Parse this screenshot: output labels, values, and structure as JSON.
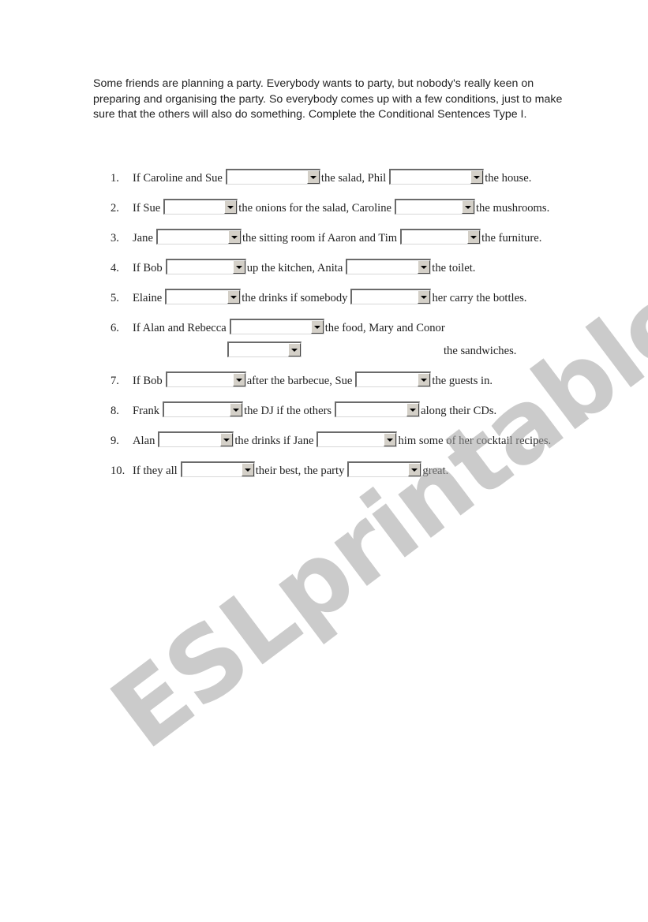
{
  "intro": "Some friends are planning a party. Everybody wants to party, but nobody's really keen on preparing and organising the party. So everybody comes up with a few conditions, just to make sure that the others will also do something. Complete the Conditional Sentences Type I.",
  "items": [
    {
      "num": "1.",
      "parts": [
        "If Caroline and Sue",
        "the salad, Phil",
        "the house."
      ],
      "selects": [
        "",
        ""
      ]
    },
    {
      "num": "2.",
      "parts": [
        "If Sue",
        "the onions for the salad, Caroline",
        "the mushrooms."
      ],
      "selects": [
        "",
        ""
      ]
    },
    {
      "num": "3.",
      "parts": [
        "Jane",
        "the sitting room if Aaron and Tim",
        "the furniture."
      ],
      "selects": [
        "",
        ""
      ]
    },
    {
      "num": "4.",
      "parts": [
        "If Bob",
        "up the kitchen, Anita",
        "the toilet."
      ],
      "selects": [
        "",
        ""
      ]
    },
    {
      "num": "5.",
      "parts": [
        "Elaine",
        "the drinks if somebody",
        "her carry the bottles."
      ],
      "selects": [
        "",
        ""
      ]
    },
    {
      "num": "6.",
      "parts": [
        "If Alan and Rebecca",
        "the food, Mary and Conor",
        "the sandwiches."
      ],
      "selects": [
        "",
        ""
      ]
    },
    {
      "num": "7.",
      "parts": [
        "If Bob",
        "after the barbecue, Sue",
        "the guests in."
      ],
      "selects": [
        "",
        ""
      ]
    },
    {
      "num": "8.",
      "parts": [
        "Frank",
        "the DJ if the others",
        "along their CDs."
      ],
      "selects": [
        "",
        ""
      ]
    },
    {
      "num": "9.",
      "parts": [
        "Alan",
        "the drinks if Jane",
        "him some of her cocktail recipes."
      ],
      "selects": [
        "",
        ""
      ]
    },
    {
      "num": "10.",
      "parts": [
        "If they all",
        "their best, the party",
        "great."
      ],
      "selects": [
        "",
        ""
      ]
    }
  ],
  "watermark": "ESLprintables.com"
}
